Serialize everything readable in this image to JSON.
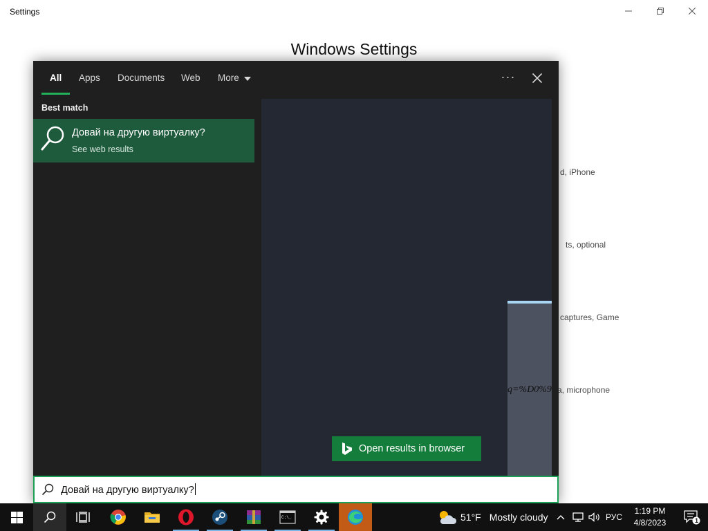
{
  "settings_window": {
    "title": "Settings",
    "heading": "Windows Settings",
    "background_descriptions": [
      "d, iPhone",
      "ts, optional",
      "captures, Game",
      "a, microphone"
    ]
  },
  "search_flyout": {
    "tabs": [
      {
        "label": "All",
        "active": true
      },
      {
        "label": "Apps"
      },
      {
        "label": "Documents"
      },
      {
        "label": "Web"
      },
      {
        "label": "More"
      }
    ],
    "best_match": {
      "label": "Best match",
      "title": "Довай на другую виртуалку?",
      "subtitle": "See web results"
    },
    "preview": {
      "url_fragment": "q=%D0%9",
      "open_in_browser_label": "Open results in browser"
    },
    "search_query": "Довай на другую виртуалку?"
  },
  "taskbar": {
    "apps": [
      "start-icon",
      "search-icon",
      "task-view-icon",
      "chrome-icon",
      "file-explorer-icon",
      "opera-icon",
      "steam-icon",
      "winrar-icon",
      "terminal-icon",
      "settings-icon",
      "edge-icon"
    ],
    "weather": {
      "temp": "51°F",
      "condition": "Mostly cloudy"
    },
    "language": "РУС",
    "time": "1:19 PM",
    "date": "4/8/2023",
    "notification_count": "1"
  },
  "colors": {
    "accent_green": "#20b15a",
    "best_match_bg": "#1e5b3c",
    "taskbar": "#111111"
  }
}
